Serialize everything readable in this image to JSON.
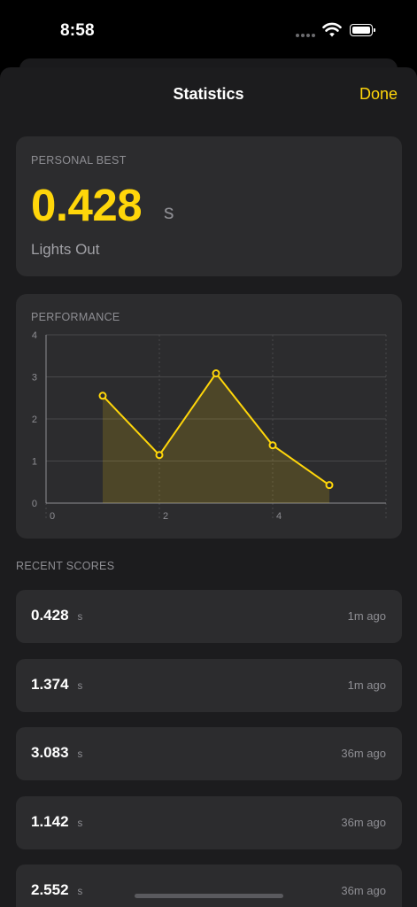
{
  "status_bar": {
    "time": "8:58"
  },
  "sheet": {
    "title": "Statistics",
    "done_label": "Done"
  },
  "personal_best": {
    "label": "PERSONAL BEST",
    "value": "0.428",
    "unit": "s",
    "mode": "Lights Out"
  },
  "performance": {
    "label": "PERFORMANCE"
  },
  "chart_data": {
    "type": "area",
    "x": [
      1,
      2,
      3,
      4,
      5
    ],
    "y": [
      2.552,
      1.142,
      3.083,
      1.374,
      0.428
    ],
    "xlim": [
      0,
      6
    ],
    "ylim": [
      0,
      4
    ],
    "xticks": [
      "0",
      "2",
      "4"
    ],
    "yticks": [
      "0",
      "1",
      "2",
      "3",
      "4"
    ],
    "grid": true,
    "color": "#ffd60a"
  },
  "recent": {
    "label": "RECENT SCORES",
    "scores": [
      {
        "value": "0.428",
        "unit": "s",
        "time": "1m ago"
      },
      {
        "value": "1.374",
        "unit": "s",
        "time": "1m ago"
      },
      {
        "value": "3.083",
        "unit": "s",
        "time": "36m ago"
      },
      {
        "value": "1.142",
        "unit": "s",
        "time": "36m ago"
      },
      {
        "value": "2.552",
        "unit": "s",
        "time": "36m ago"
      }
    ]
  },
  "colors": {
    "accent": "#ffd60a",
    "card": "#2c2c2e",
    "sheet": "#1c1c1e"
  }
}
